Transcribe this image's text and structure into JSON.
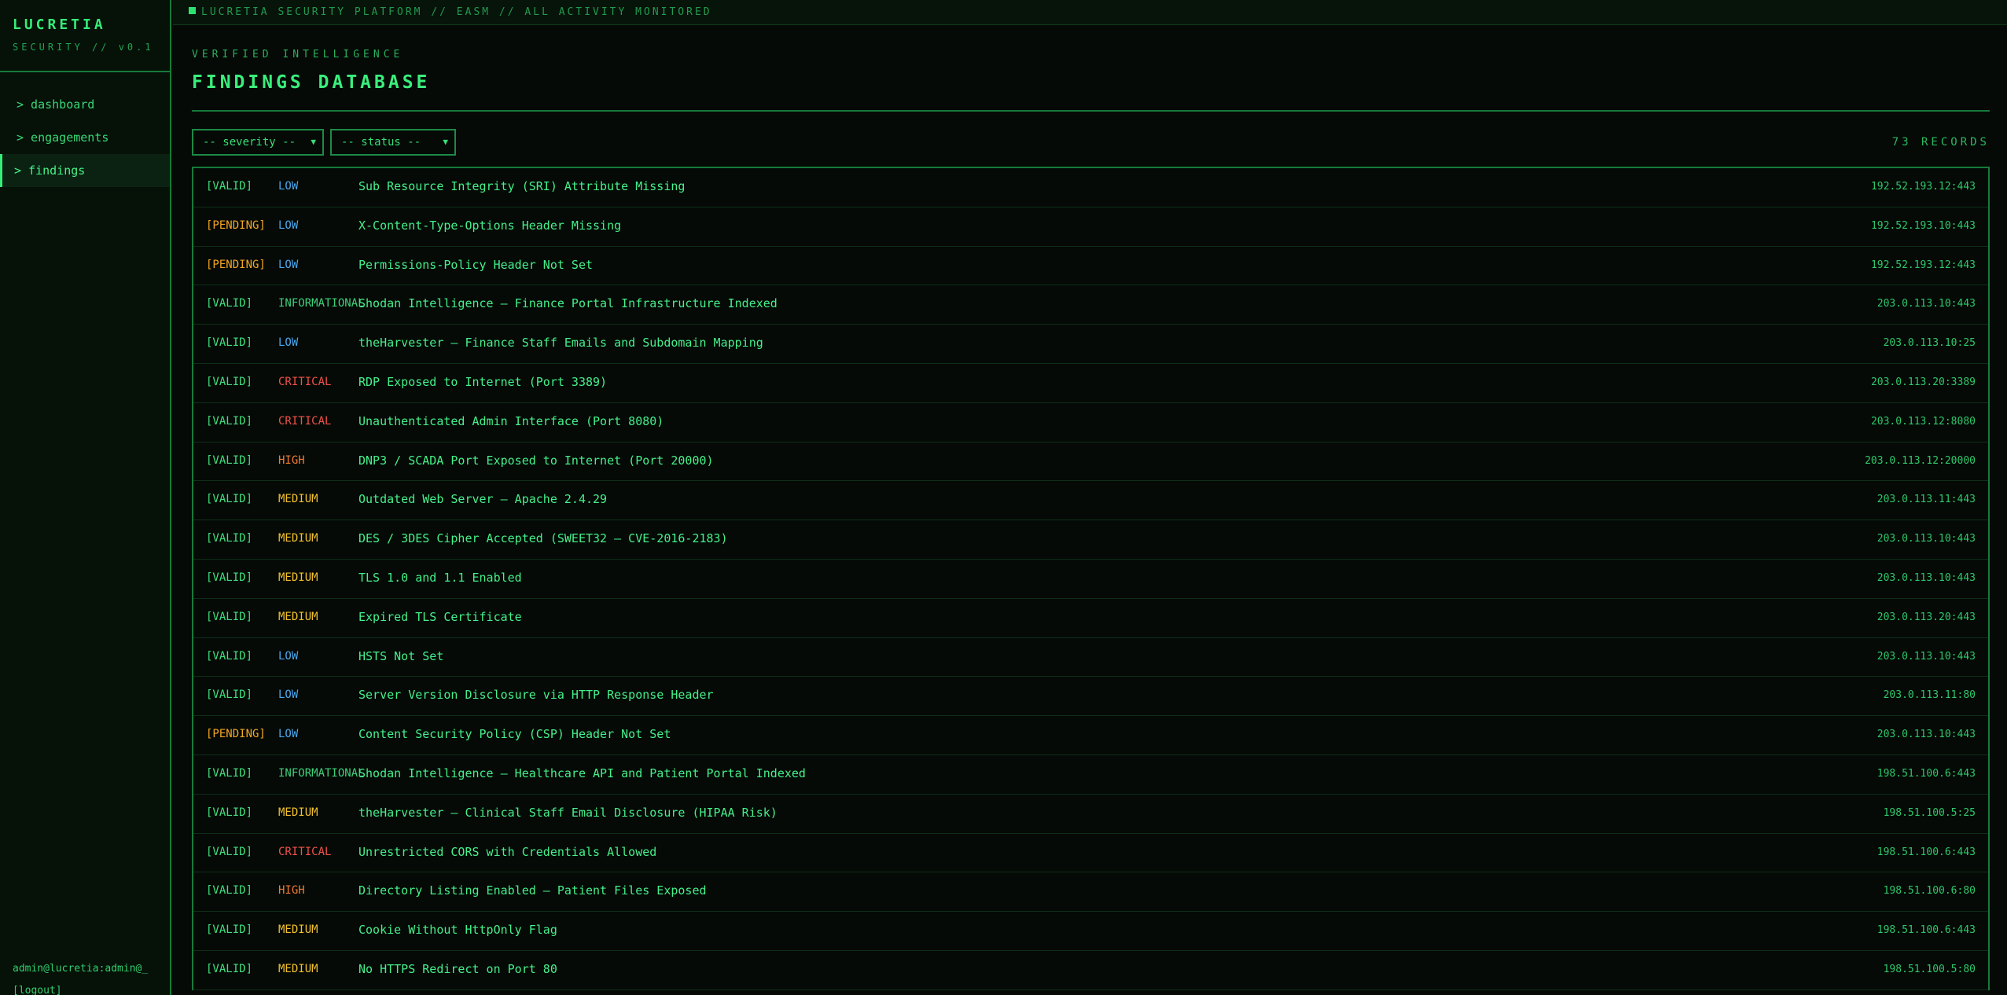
{
  "brand": {
    "title": "LUCRETIA",
    "subtitle": "SECURITY // v0.1"
  },
  "nav": {
    "dashboard": "> dashboard",
    "engagements": "> engagements",
    "findings": "> findings"
  },
  "user": {
    "account": "admin@lucretia:admin@_",
    "logout": "[logout]"
  },
  "topbar": {
    "text": "LUCRETIA SECURITY PLATFORM // EASM // ALL ACTIVITY MONITORED"
  },
  "page": {
    "eyebrow": "VERIFIED INTELLIGENCE",
    "title": "FINDINGS DATABASE"
  },
  "filters": {
    "severity": "-- severity --",
    "status": "-- status --",
    "record_count": "73 RECORDS"
  },
  "colors": {
    "status": {
      "VALID": "#3fe07e",
      "PENDING": "#f5a623"
    },
    "severity": {
      "LOW": "#4aa8f0",
      "INFORMATIONAL": "#3fd07a",
      "CRITICAL": "#f0524a",
      "HIGH": "#f07a34",
      "MEDIUM": "#f2c12e"
    }
  },
  "findings": [
    {
      "status": "[VALID]",
      "severity": "LOW",
      "title": "Sub Resource Integrity (SRI) Attribute Missing",
      "target": "192.52.193.12:443"
    },
    {
      "status": "[PENDING]",
      "severity": "LOW",
      "title": "X-Content-Type-Options Header Missing",
      "target": "192.52.193.10:443"
    },
    {
      "status": "[PENDING]",
      "severity": "LOW",
      "title": "Permissions-Policy Header Not Set",
      "target": "192.52.193.12:443"
    },
    {
      "status": "[VALID]",
      "severity": "INFORMATIONAL",
      "title": "Shodan Intelligence — Finance Portal Infrastructure Indexed",
      "target": "203.0.113.10:443"
    },
    {
      "status": "[VALID]",
      "severity": "LOW",
      "title": "theHarvester — Finance Staff Emails and Subdomain Mapping",
      "target": "203.0.113.10:25"
    },
    {
      "status": "[VALID]",
      "severity": "CRITICAL",
      "title": "RDP Exposed to Internet (Port 3389)",
      "target": "203.0.113.20:3389"
    },
    {
      "status": "[VALID]",
      "severity": "CRITICAL",
      "title": "Unauthenticated Admin Interface (Port 8080)",
      "target": "203.0.113.12:8080"
    },
    {
      "status": "[VALID]",
      "severity": "HIGH",
      "title": "DNP3 / SCADA Port Exposed to Internet (Port 20000)",
      "target": "203.0.113.12:20000"
    },
    {
      "status": "[VALID]",
      "severity": "MEDIUM",
      "title": "Outdated Web Server — Apache 2.4.29",
      "target": "203.0.113.11:443"
    },
    {
      "status": "[VALID]",
      "severity": "MEDIUM",
      "title": "DES / 3DES Cipher Accepted (SWEET32 — CVE-2016-2183)",
      "target": "203.0.113.10:443"
    },
    {
      "status": "[VALID]",
      "severity": "MEDIUM",
      "title": "TLS 1.0 and 1.1 Enabled",
      "target": "203.0.113.10:443"
    },
    {
      "status": "[VALID]",
      "severity": "MEDIUM",
      "title": "Expired TLS Certificate",
      "target": "203.0.113.20:443"
    },
    {
      "status": "[VALID]",
      "severity": "LOW",
      "title": "HSTS Not Set",
      "target": "203.0.113.10:443"
    },
    {
      "status": "[VALID]",
      "severity": "LOW",
      "title": "Server Version Disclosure via HTTP Response Header",
      "target": "203.0.113.11:80"
    },
    {
      "status": "[PENDING]",
      "severity": "LOW",
      "title": "Content Security Policy (CSP) Header Not Set",
      "target": "203.0.113.10:443"
    },
    {
      "status": "[VALID]",
      "severity": "INFORMATIONAL",
      "title": "Shodan Intelligence — Healthcare API and Patient Portal Indexed",
      "target": "198.51.100.6:443"
    },
    {
      "status": "[VALID]",
      "severity": "MEDIUM",
      "title": "theHarvester — Clinical Staff Email Disclosure (HIPAA Risk)",
      "target": "198.51.100.5:25"
    },
    {
      "status": "[VALID]",
      "severity": "CRITICAL",
      "title": "Unrestricted CORS with Credentials Allowed",
      "target": "198.51.100.6:443"
    },
    {
      "status": "[VALID]",
      "severity": "HIGH",
      "title": "Directory Listing Enabled — Patient Files Exposed",
      "target": "198.51.100.6:80"
    },
    {
      "status": "[VALID]",
      "severity": "MEDIUM",
      "title": "Cookie Without HttpOnly Flag",
      "target": "198.51.100.6:443"
    },
    {
      "status": "[VALID]",
      "severity": "MEDIUM",
      "title": "No HTTPS Redirect on Port 80",
      "target": "198.51.100.5:80"
    }
  ]
}
